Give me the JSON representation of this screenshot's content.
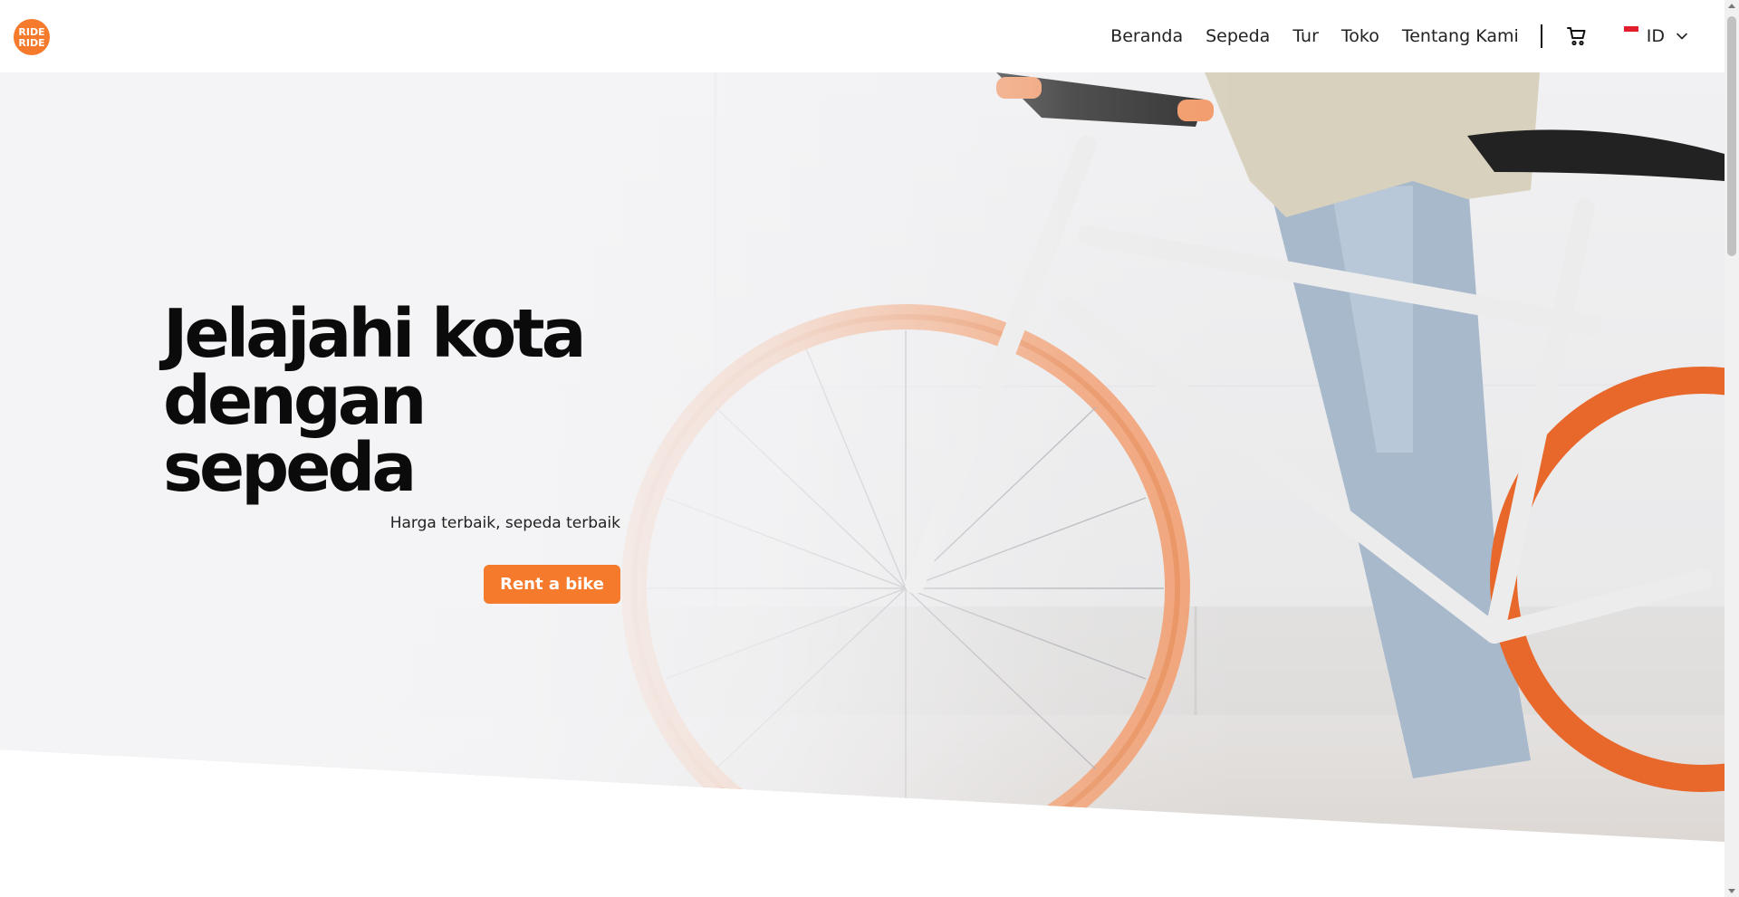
{
  "brand": {
    "logo_lines": [
      "RIDE",
      "RIDE"
    ],
    "accent_color": "#f57a2b"
  },
  "nav": {
    "items": [
      {
        "label": "Beranda"
      },
      {
        "label": "Sepeda"
      },
      {
        "label": "Tur"
      },
      {
        "label": "Toko"
      },
      {
        "label": "Tentang Kami"
      }
    ],
    "cart_icon": "cart-icon",
    "language": {
      "code": "ID",
      "flag": "indonesia-flag-icon"
    }
  },
  "hero": {
    "title_line1": "Jelajahi kota",
    "title_line2": "dengan sepeda",
    "subtitle": "Harga terbaik, sepeda terbaik",
    "cta_label": "Rent a bike"
  }
}
